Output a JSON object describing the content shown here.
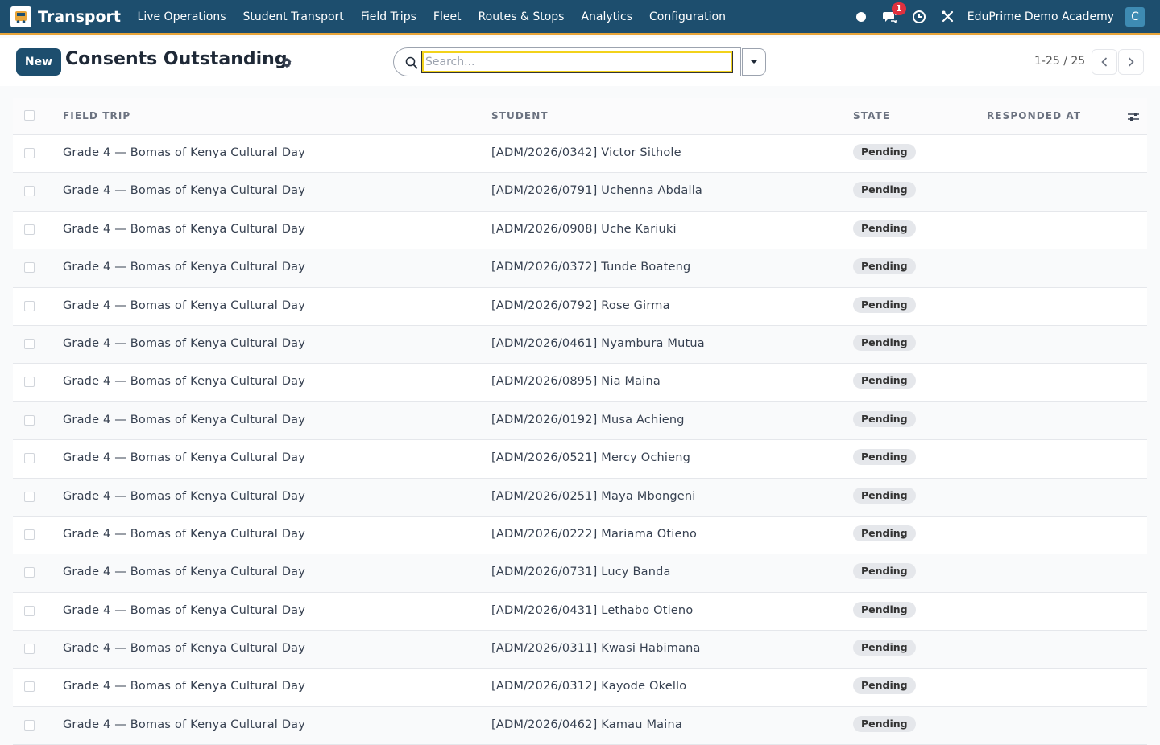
{
  "app": {
    "name": "Transport"
  },
  "nav": {
    "items": [
      {
        "label": "Live Operations"
      },
      {
        "label": "Student Transport"
      },
      {
        "label": "Field Trips"
      },
      {
        "label": "Fleet"
      },
      {
        "label": "Routes & Stops"
      },
      {
        "label": "Analytics"
      },
      {
        "label": "Configuration"
      }
    ],
    "messages_badge": "1",
    "company": "EduPrime Demo Academy",
    "avatar_initial": "C"
  },
  "control": {
    "new_label": "New",
    "title": "Consents Outstanding",
    "search_placeholder": "Search...",
    "pager": "1-25 / 25"
  },
  "table": {
    "columns": [
      "FIELD TRIP",
      "STUDENT",
      "STATE",
      "RESPONDED AT"
    ],
    "rows": [
      {
        "trip": "Grade 4 — Bomas of Kenya Cultural Day",
        "student": "[ADM/2026/0342] Victor Sithole",
        "state": "Pending"
      },
      {
        "trip": "Grade 4 — Bomas of Kenya Cultural Day",
        "student": "[ADM/2026/0791] Uchenna Abdalla",
        "state": "Pending"
      },
      {
        "trip": "Grade 4 — Bomas of Kenya Cultural Day",
        "student": "[ADM/2026/0908] Uche Kariuki",
        "state": "Pending"
      },
      {
        "trip": "Grade 4 — Bomas of Kenya Cultural Day",
        "student": "[ADM/2026/0372] Tunde Boateng",
        "state": "Pending"
      },
      {
        "trip": "Grade 4 — Bomas of Kenya Cultural Day",
        "student": "[ADM/2026/0792] Rose Girma",
        "state": "Pending"
      },
      {
        "trip": "Grade 4 — Bomas of Kenya Cultural Day",
        "student": "[ADM/2026/0461] Nyambura Mutua",
        "state": "Pending"
      },
      {
        "trip": "Grade 4 — Bomas of Kenya Cultural Day",
        "student": "[ADM/2026/0895] Nia Maina",
        "state": "Pending"
      },
      {
        "trip": "Grade 4 — Bomas of Kenya Cultural Day",
        "student": "[ADM/2026/0192] Musa Achieng",
        "state": "Pending"
      },
      {
        "trip": "Grade 4 — Bomas of Kenya Cultural Day",
        "student": "[ADM/2026/0521] Mercy Ochieng",
        "state": "Pending"
      },
      {
        "trip": "Grade 4 — Bomas of Kenya Cultural Day",
        "student": "[ADM/2026/0251] Maya Mbongeni",
        "state": "Pending"
      },
      {
        "trip": "Grade 4 — Bomas of Kenya Cultural Day",
        "student": "[ADM/2026/0222] Mariama Otieno",
        "state": "Pending"
      },
      {
        "trip": "Grade 4 — Bomas of Kenya Cultural Day",
        "student": "[ADM/2026/0731] Lucy Banda",
        "state": "Pending"
      },
      {
        "trip": "Grade 4 — Bomas of Kenya Cultural Day",
        "student": "[ADM/2026/0431] Lethabo Otieno",
        "state": "Pending"
      },
      {
        "trip": "Grade 4 — Bomas of Kenya Cultural Day",
        "student": "[ADM/2026/0311] Kwasi Habimana",
        "state": "Pending"
      },
      {
        "trip": "Grade 4 — Bomas of Kenya Cultural Day",
        "student": "[ADM/2026/0312] Kayode Okello",
        "state": "Pending"
      },
      {
        "trip": "Grade 4 — Bomas of Kenya Cultural Day",
        "student": "[ADM/2026/0462] Kamau Maina",
        "state": "Pending"
      }
    ]
  },
  "colors": {
    "navbar": "#1d4e6e",
    "navbar_accent": "#e8a53a",
    "primary_button": "#1d4e6e",
    "badge_red": "#e0313f",
    "avatar": "#3e8bb3",
    "search_focus": "#f2d21b"
  },
  "icons": [
    "app-logo-icon",
    "status-dot-icon",
    "messages-icon",
    "activity-clock-icon",
    "tools-icon",
    "gear-icon",
    "search-icon",
    "caret-down-icon",
    "chevron-left-icon",
    "chevron-right-icon",
    "optional-columns-icon"
  ]
}
